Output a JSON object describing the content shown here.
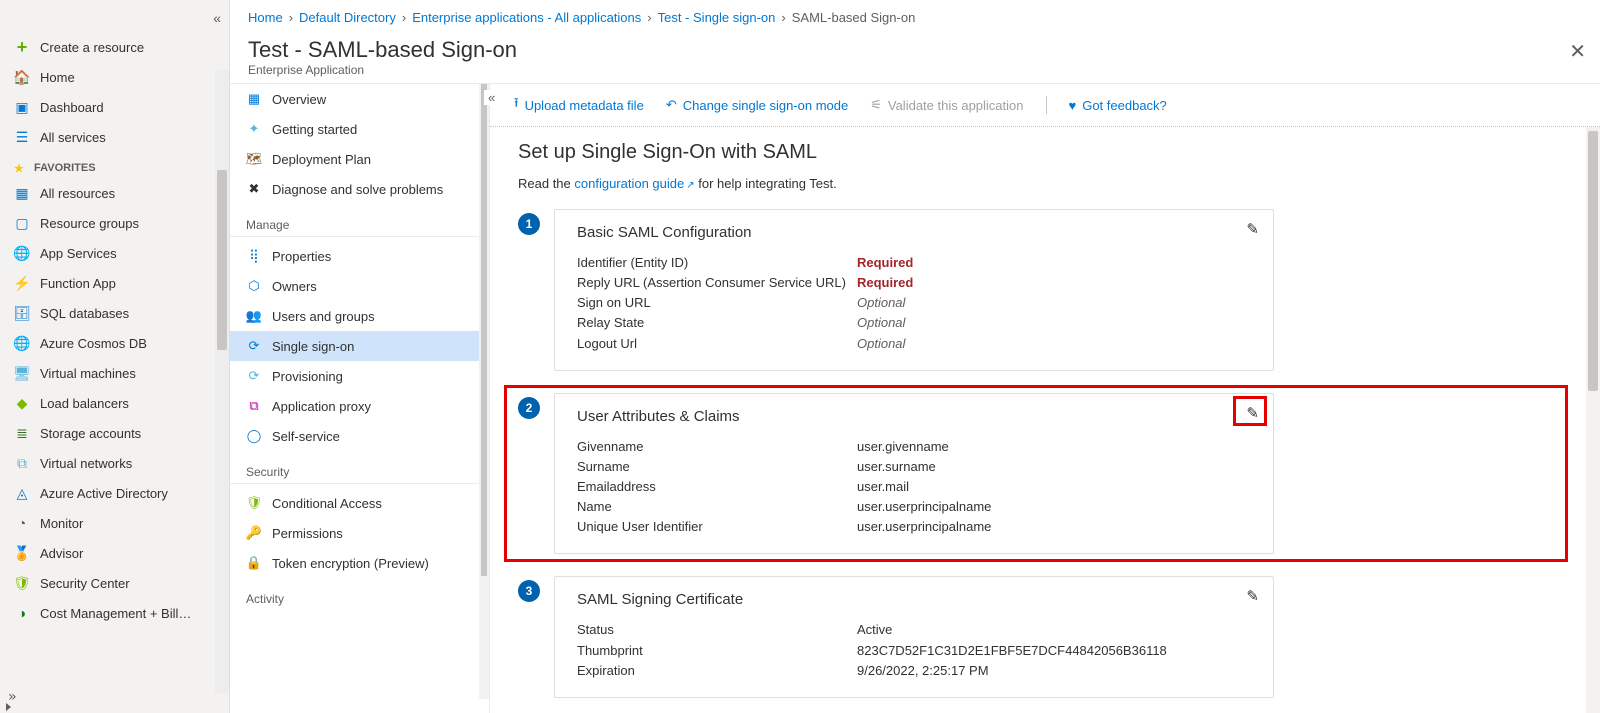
{
  "favorites": {
    "create": "Create a resource",
    "home": "Home",
    "dashboard": "Dashboard",
    "all_services": "All services",
    "header": "Favorites",
    "items": [
      "All resources",
      "Resource groups",
      "App Services",
      "Function App",
      "SQL databases",
      "Azure Cosmos DB",
      "Virtual machines",
      "Load balancers",
      "Storage accounts",
      "Virtual networks",
      "Azure Active Directory",
      "Monitor",
      "Advisor",
      "Security Center",
      "Cost Management + Bill…"
    ]
  },
  "crumbs": [
    "Home",
    "Default Directory",
    "Enterprise applications - All applications",
    "Test - Single sign-on",
    "SAML-based Sign-on"
  ],
  "page": {
    "title": "Test - SAML-based Sign-on",
    "subtitle": "Enterprise Application"
  },
  "midnav": {
    "top": [
      "Overview",
      "Getting started",
      "Deployment Plan",
      "Diagnose and solve problems"
    ],
    "manage_header": "Manage",
    "manage": [
      "Properties",
      "Owners",
      "Users and groups",
      "Single sign-on",
      "Provisioning",
      "Application proxy",
      "Self-service"
    ],
    "security_header": "Security",
    "security": [
      "Conditional Access",
      "Permissions",
      "Token encryption (Preview)"
    ],
    "activity_header": "Activity"
  },
  "toolbar": {
    "upload": "Upload metadata file",
    "change": "Change single sign-on mode",
    "validate": "Validate this application",
    "feedback": "Got feedback?"
  },
  "content": {
    "h1": "Set up Single Sign-On with SAML",
    "help_pre": "Read the ",
    "help_link": "configuration guide",
    "help_post": " for help integrating Test.",
    "cards": [
      {
        "title": "Basic SAML Configuration",
        "rows": [
          {
            "k": "Identifier (Entity ID)",
            "v": "Required",
            "cls": "req"
          },
          {
            "k": "Reply URL (Assertion Consumer Service URL)",
            "v": "Required",
            "cls": "req"
          },
          {
            "k": "Sign on URL",
            "v": "Optional",
            "cls": "opt"
          },
          {
            "k": "Relay State",
            "v": "Optional",
            "cls": "opt"
          },
          {
            "k": "Logout Url",
            "v": "Optional",
            "cls": "opt"
          }
        ]
      },
      {
        "title": "User Attributes & Claims",
        "rows": [
          {
            "k": "Givenname",
            "v": "user.givenname",
            "cls": ""
          },
          {
            "k": "Surname",
            "v": "user.surname",
            "cls": ""
          },
          {
            "k": "Emailaddress",
            "v": "user.mail",
            "cls": ""
          },
          {
            "k": "Name",
            "v": "user.userprincipalname",
            "cls": ""
          },
          {
            "k": "Unique User Identifier",
            "v": "user.userprincipalname",
            "cls": ""
          }
        ]
      },
      {
        "title": "SAML Signing Certificate",
        "rows": [
          {
            "k": "Status",
            "v": "Active",
            "cls": ""
          },
          {
            "k": "Thumbprint",
            "v": "823C7D52F1C31D2E1FBF5E7DCF44842056B36118",
            "cls": ""
          },
          {
            "k": "Expiration",
            "v": "9/26/2022, 2:25:17 PM",
            "cls": ""
          }
        ]
      }
    ]
  }
}
